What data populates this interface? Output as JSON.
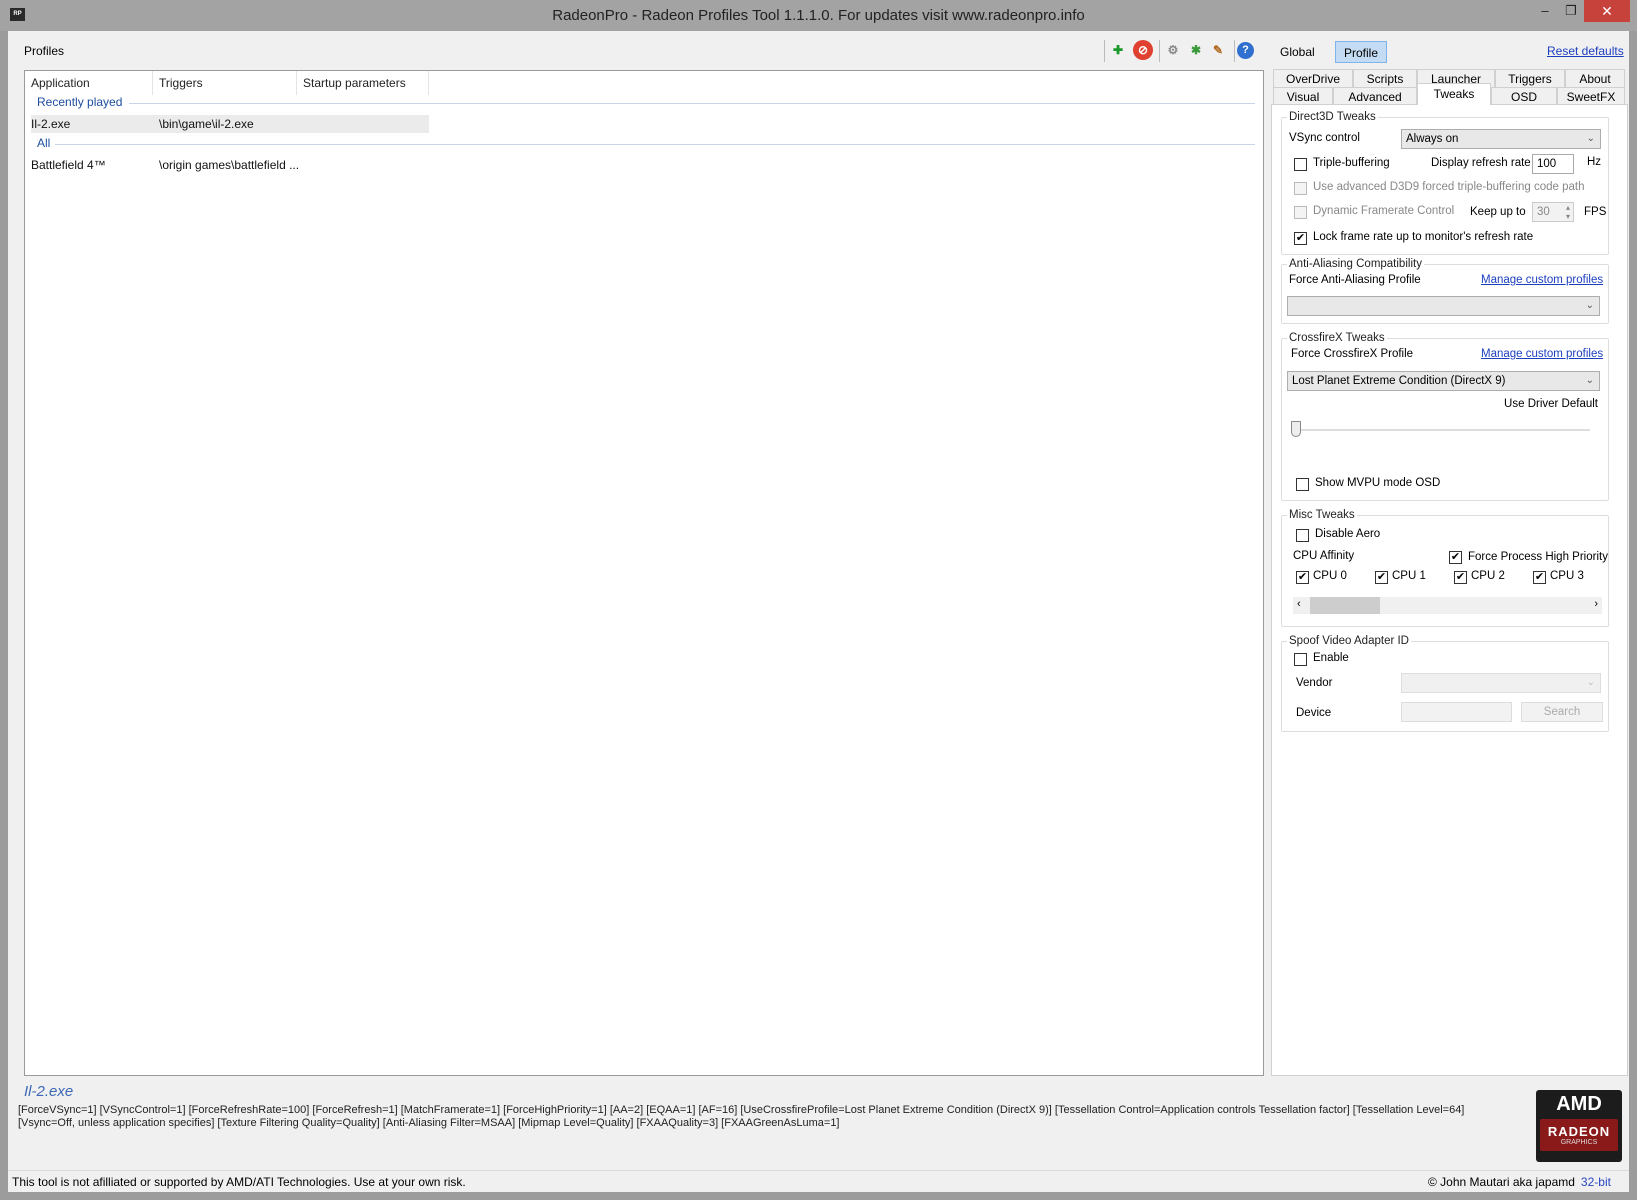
{
  "window": {
    "title": "RadeonPro - Radeon Profiles Tool 1.1.1.0. For updates visit www.radeonpro.info",
    "app_icon": "RP",
    "minimize": "–",
    "maximize": "❐",
    "close": "✕"
  },
  "profiles": {
    "label": "Profiles",
    "columns": [
      "Application",
      "Triggers",
      "Startup parameters"
    ],
    "groups": [
      {
        "label": "Recently played",
        "rows": [
          {
            "app": "Il-2.exe",
            "trigger": "\\bin\\game\\il-2.exe",
            "params": ""
          }
        ]
      },
      {
        "label": "All",
        "rows": [
          {
            "app": "Battlefield 4™",
            "trigger": "\\origin games\\battlefield ...",
            "params": ""
          }
        ]
      }
    ]
  },
  "toolbar": {
    "icons": [
      "add-profile-icon",
      "delete-profile-icon",
      "settings-icon",
      "import-icon",
      "clean-icon",
      "help-icon"
    ]
  },
  "scope": {
    "global": "Global",
    "profile": "Profile",
    "reset": "Reset defaults"
  },
  "tabs": {
    "row1": [
      "OverDrive",
      "Scripts",
      "Launcher",
      "Triggers",
      "About"
    ],
    "row2": [
      "Visual",
      "Advanced",
      "Tweaks",
      "OSD",
      "SweetFX"
    ],
    "active": "Tweaks"
  },
  "d3d": {
    "legend": "Direct3D Tweaks",
    "vsync_label": "VSync control",
    "vsync_value": "Always on",
    "triple": "Triple-buffering",
    "triple_checked": false,
    "refresh_label": "Display refresh rate",
    "refresh_value": "100",
    "hz": "Hz",
    "advanced": "Use advanced D3D9 forced triple-buffering code path",
    "dfc": "Dynamic Framerate Control",
    "keep": "Keep up to",
    "fps_value": "30",
    "fps": "FPS",
    "lock": "Lock frame rate up to monitor's refresh rate",
    "lock_checked": true
  },
  "aa": {
    "legend": "Anti-Aliasing Compatibility",
    "label": "Force Anti-Aliasing Profile",
    "manage": "Manage custom profiles",
    "value": ""
  },
  "cfx": {
    "legend": "CrossfireX Tweaks",
    "label": "Force CrossfireX Profile",
    "manage": "Manage custom profiles",
    "value": "Lost Planet Extreme Condition (DirectX 9)",
    "slider_caption": "Use Driver Default",
    "slider_position": 0,
    "mvpu": "Show MVPU mode OSD"
  },
  "misc": {
    "legend": "Misc Tweaks",
    "aero": "Disable Aero",
    "affinity": "CPU Affinity",
    "priority": "Force Process High Priority",
    "cpus": [
      "CPU 0",
      "CPU 1",
      "CPU 2",
      "CPU 3"
    ]
  },
  "spoof": {
    "legend": "Spoof Video Adapter ID",
    "enable": "Enable",
    "vendor": "Vendor",
    "device": "Device",
    "search": "Search"
  },
  "summary": {
    "title": "Il-2.exe",
    "text": "[ForceVSync=1] [VSyncControl=1] [ForceRefreshRate=100] [ForceRefresh=1] [MatchFramerate=1] [ForceHighPriority=1] [AA=2] [EQAA=1] [AF=16] [UseCrossfireProfile=Lost Planet Extreme Condition (DirectX 9)] [Tessellation Control=Application controls Tessellation factor] [Tessellation Level=64] [Vsync=Off, unless application specifies] [Texture Filtering Quality=Quality] [Anti-Aliasing Filter=MSAA] [Mipmap Level=Quality] [FXAAQuality=3] [FXAAGreenAsLuma=1]"
  },
  "logo": {
    "brand": "AMD",
    "product": "RADEON",
    "sub": "GRAPHICS"
  },
  "status": {
    "disclaimer": "This tool is not afilliated or supported by AMD/ATI Technologies. Use at your own risk.",
    "author": "© John Mautari aka japamd",
    "bits": "32-bit"
  }
}
